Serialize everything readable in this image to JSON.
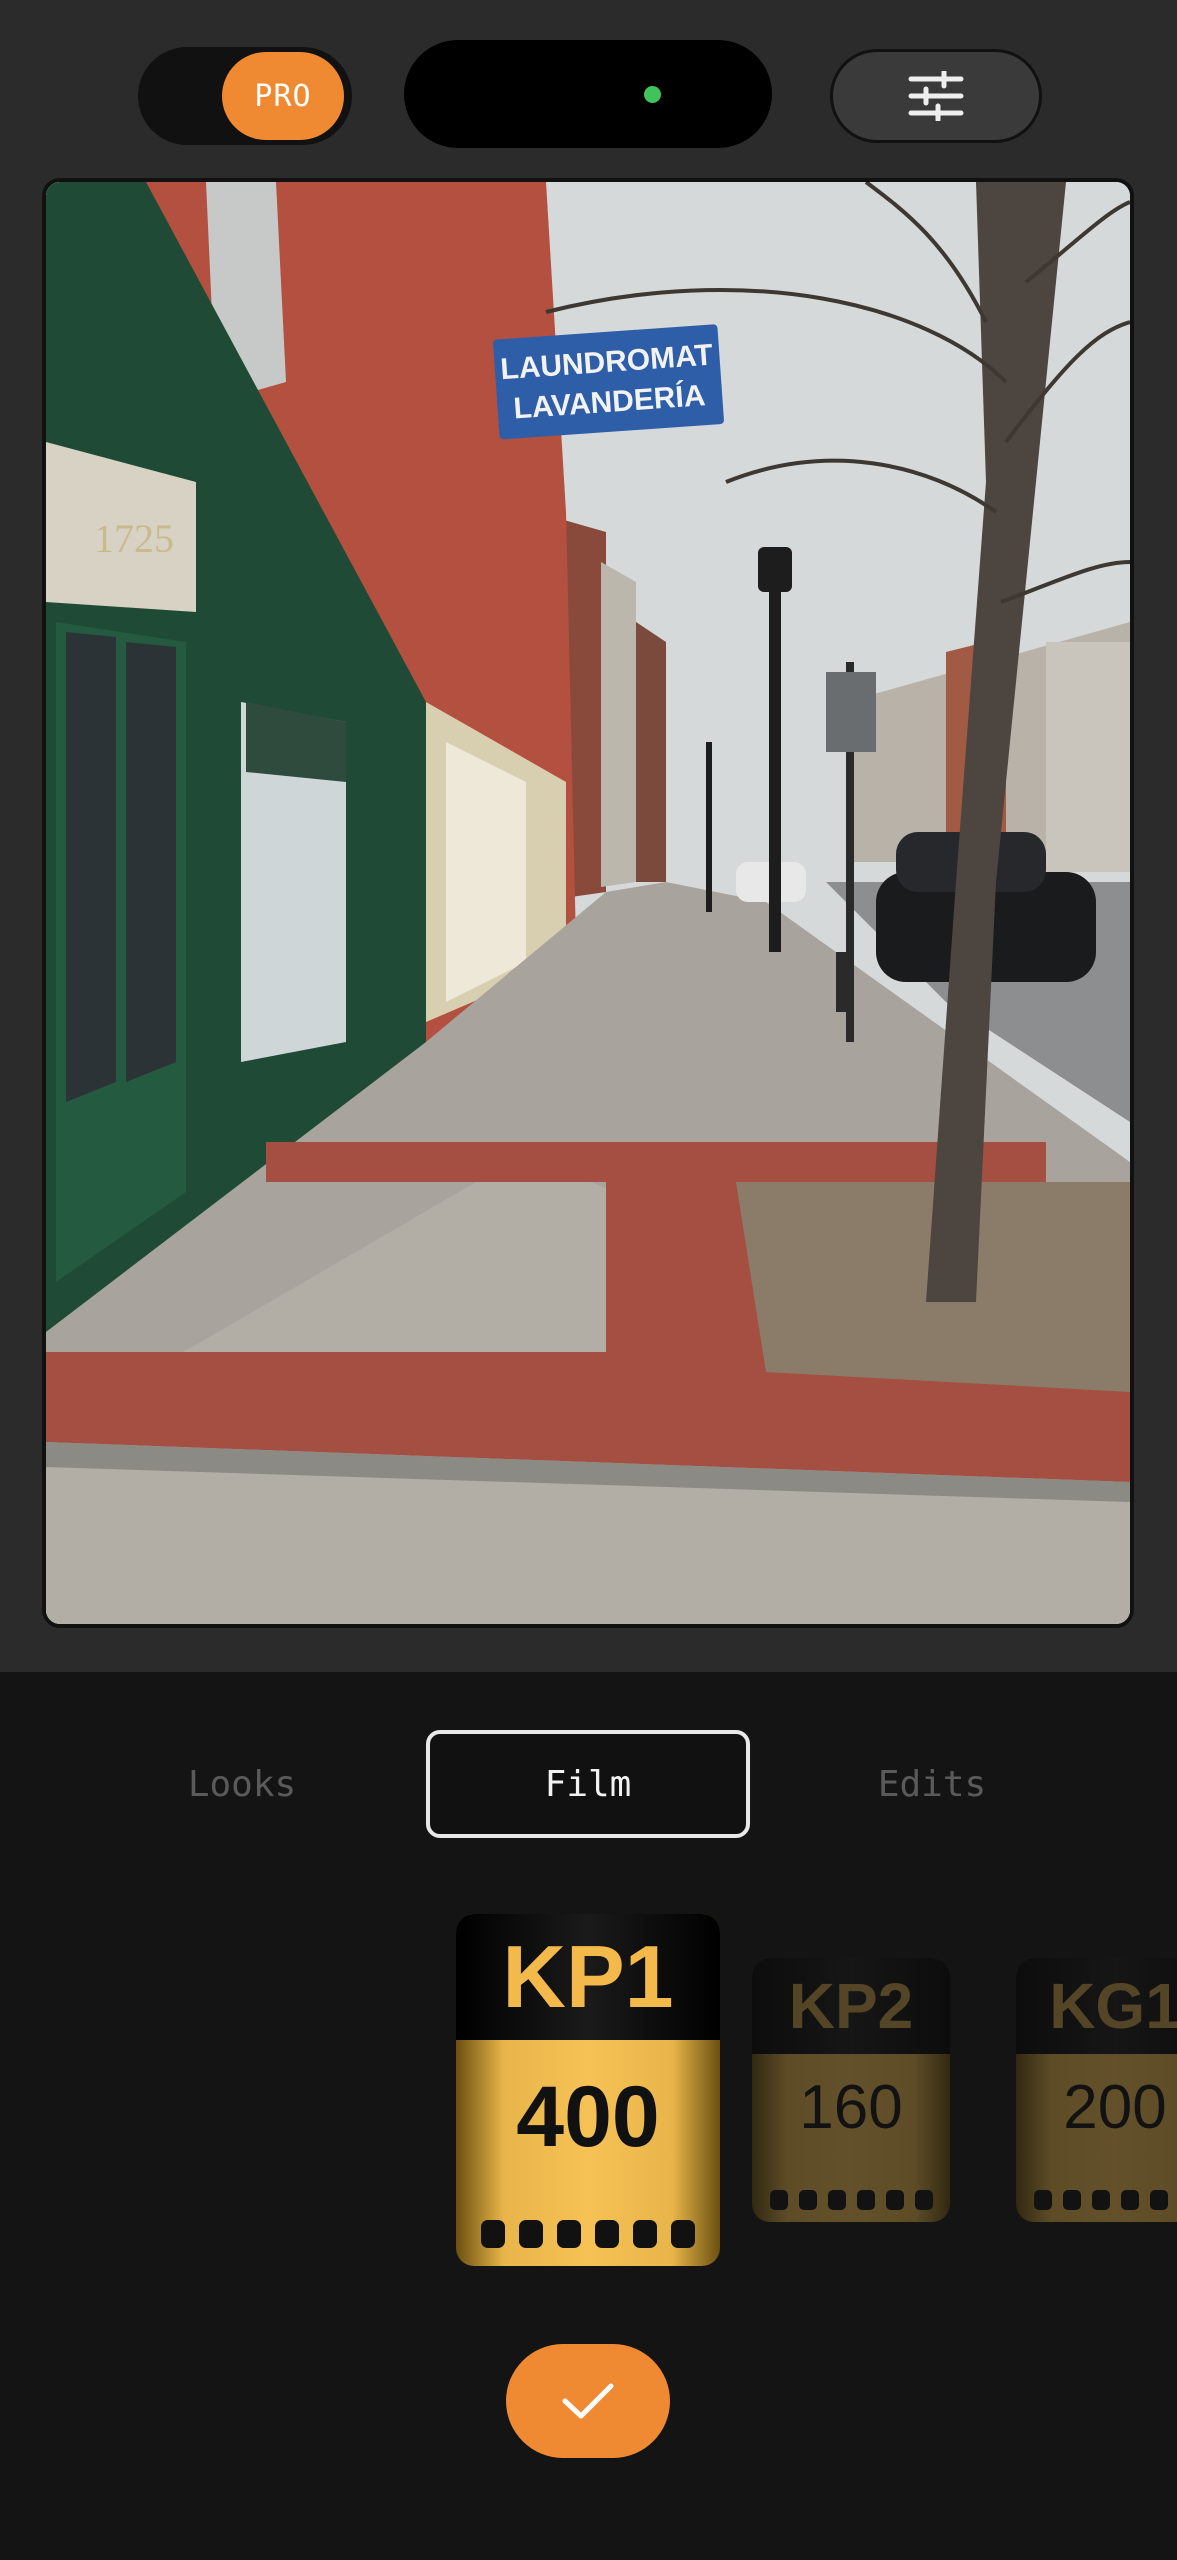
{
  "top_bar": {
    "pro_label": "PRO",
    "accent": "#f08a32",
    "status_dot_color": "#3ec45a",
    "settings_icon": "sliders-icon"
  },
  "photo": {
    "sign_line1": "LAUNDROMAT",
    "sign_line2": "LAVANDERÍA",
    "door_number": "1725"
  },
  "tabs": [
    {
      "label": "Looks",
      "active": false
    },
    {
      "label": "Film",
      "active": true
    },
    {
      "label": "Edits",
      "active": false
    }
  ],
  "films": [
    {
      "name": "KP1",
      "iso": "400",
      "selected": true
    },
    {
      "name": "KP2",
      "iso": "160",
      "selected": false
    },
    {
      "name": "KG1",
      "iso": "200",
      "selected": false
    }
  ],
  "confirm_icon": "checkmark-icon"
}
